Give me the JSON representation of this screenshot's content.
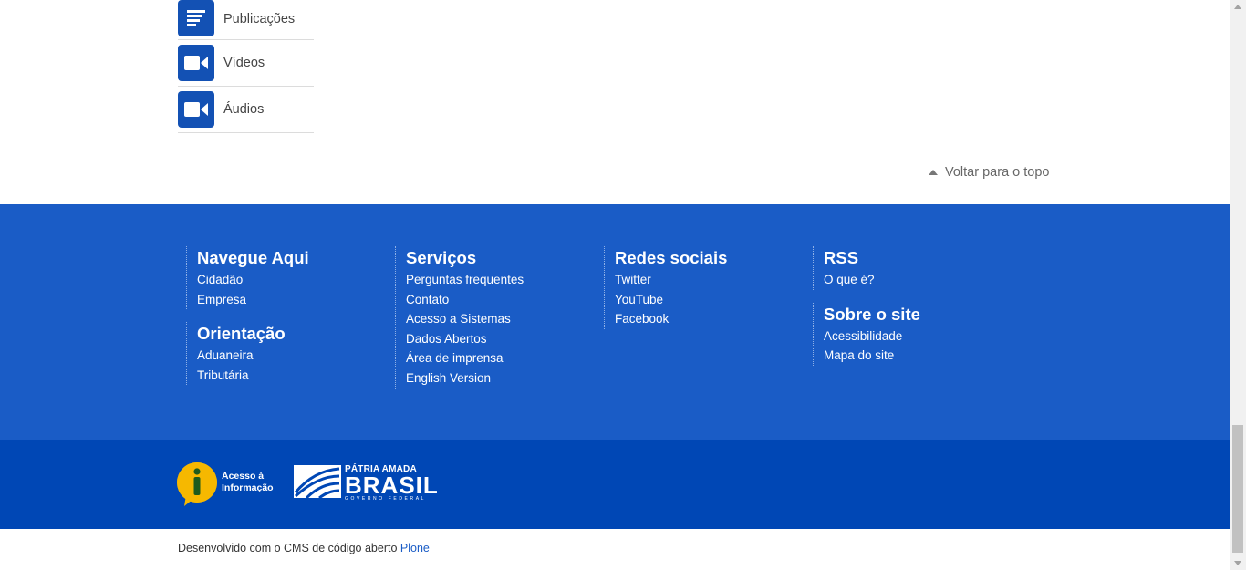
{
  "side_menu": {
    "items": [
      {
        "label": "Publicações",
        "icon": "document-lines-icon"
      },
      {
        "label": "Vídeos",
        "icon": "video-camera-icon"
      },
      {
        "label": "Áudios",
        "icon": "video-camera-icon"
      }
    ]
  },
  "back_to_top": "Voltar para o topo",
  "footer": {
    "navegue": {
      "title": "Navegue Aqui",
      "links": [
        "Cidadão",
        "Empresa"
      ]
    },
    "orientacao": {
      "title": "Orientação",
      "links": [
        "Aduaneira",
        "Tributária"
      ]
    },
    "servicos": {
      "title": "Serviços",
      "links": [
        "Perguntas frequentes",
        "Contato",
        "Acesso a Sistemas",
        "Dados Abertos",
        "Área de imprensa",
        "English Version"
      ]
    },
    "redes": {
      "title": "Redes sociais",
      "links": [
        "Twitter",
        "YouTube",
        "Facebook"
      ]
    },
    "rss": {
      "title": "RSS",
      "links": [
        "O que é?"
      ]
    },
    "sobre": {
      "title": "Sobre o site",
      "links": [
        "Acessibilidade",
        "Mapa do site"
      ]
    }
  },
  "logos": {
    "acesso_line1": "Acesso à",
    "acesso_line2": "Informação",
    "brasil_small": "PÁTRIA AMADA",
    "brasil_big": "BRASIL",
    "brasil_tiny": "GOVERNO FEDERAL"
  },
  "credits": {
    "text": "Desenvolvido com o CMS de código aberto ",
    "link": "Plone"
  },
  "colors": {
    "primary": "#1a5cc6",
    "dark": "#0047b5",
    "icon_bg": "#1351b4",
    "accent": "#f6b800"
  }
}
